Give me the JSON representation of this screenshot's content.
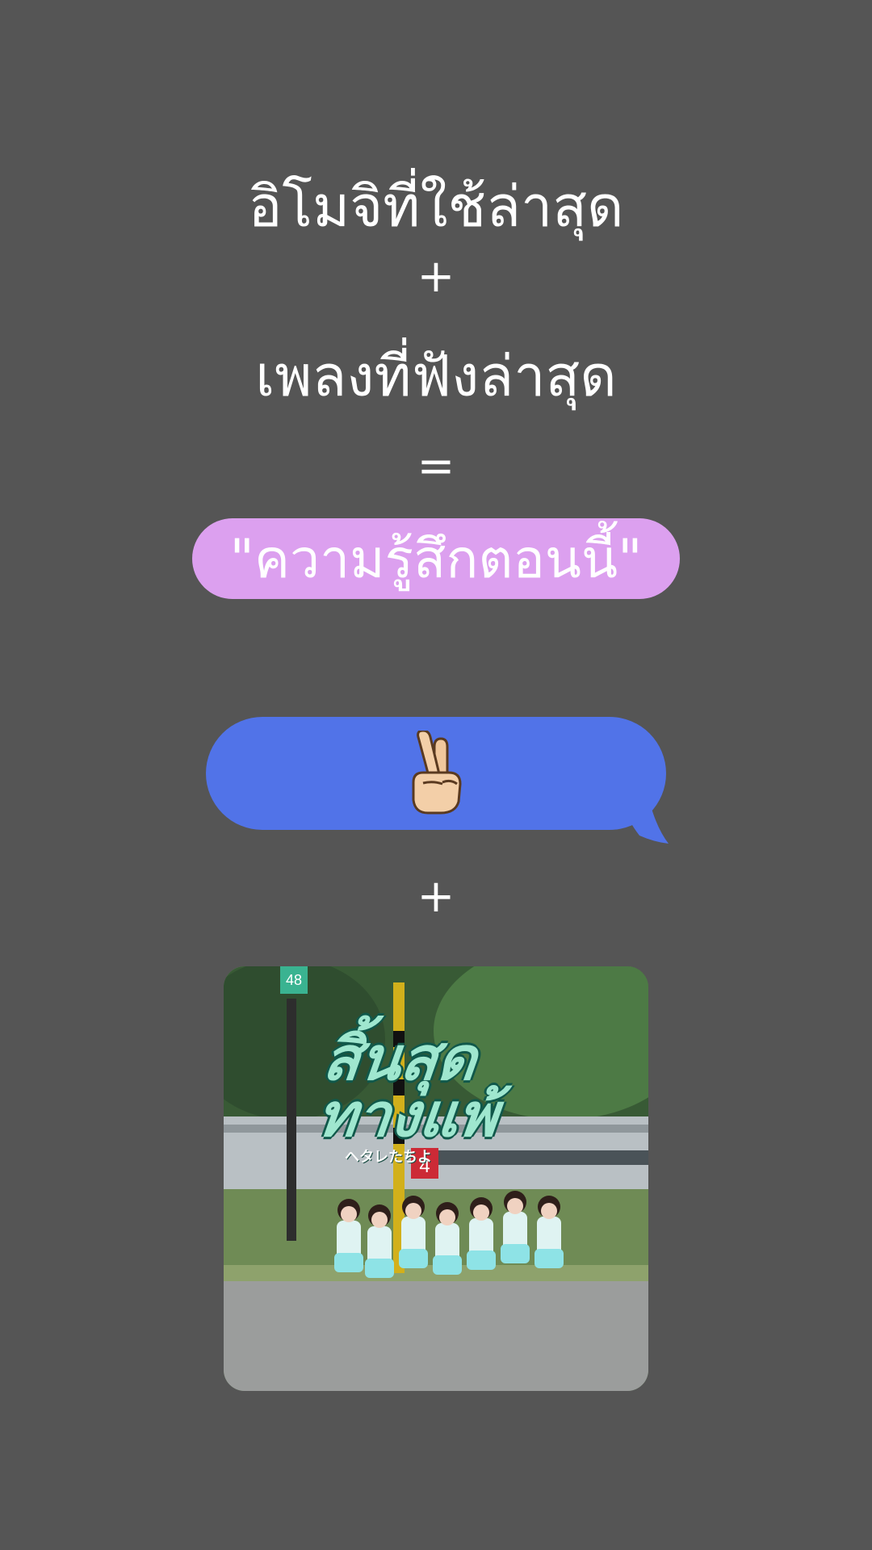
{
  "caption": {
    "line1": "อิโมจิที่ใช้ล่าสุด",
    "plus1": "+",
    "line2": "เพลงที่ฟังล่าสุด",
    "equals": "=",
    "result": "\"ความรู้สึกตอนนี้\"",
    "plus2": "+"
  },
  "emoji_bubble": {
    "emoji": "victory-hand",
    "bubble_color": "#5173E8"
  },
  "album": {
    "title": "สิ้นสุด\nทางแพ้",
    "subtitle": "ヘタレたちよ",
    "badge": "48",
    "sign_number": "4"
  },
  "colors": {
    "background": "#555555",
    "pill": "#DCA0EF",
    "text": "#FFFFFF",
    "album_title": "#9FE7CF"
  }
}
